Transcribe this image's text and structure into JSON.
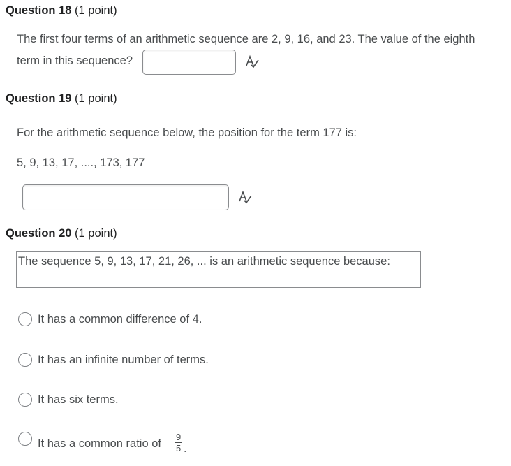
{
  "q18": {
    "title": "Question 18",
    "points": "(1 point)",
    "line1": "The first four terms of an arithmetic sequence are 2, 9, 16, and 23. The value of the eighth",
    "line2": "term in this sequence?",
    "answer_value": ""
  },
  "q19": {
    "title": "Question 19",
    "points": "(1 point)",
    "prompt": "For the arithmetic sequence below, the position for the term 177 is:",
    "sequence": "5, 9, 13, 17, ...., 173, 177",
    "answer_value": ""
  },
  "q20": {
    "title": "Question 20",
    "points": "(1 point)",
    "prompt": "The sequence 5, 9, 13, 17, 21, 26, ... is an arithmetic sequence because:",
    "options": [
      {
        "label": "It has a common difference of 4."
      },
      {
        "label": "It has an infinite number of terms."
      },
      {
        "label": "It has six terms."
      },
      {
        "label": "It has a common ratio of",
        "frac_num": "9",
        "frac_den": "5",
        "suffix": "."
      }
    ]
  },
  "icons": {
    "spellcheck": "spellcheck-icon",
    "radio": "radio-icon"
  }
}
